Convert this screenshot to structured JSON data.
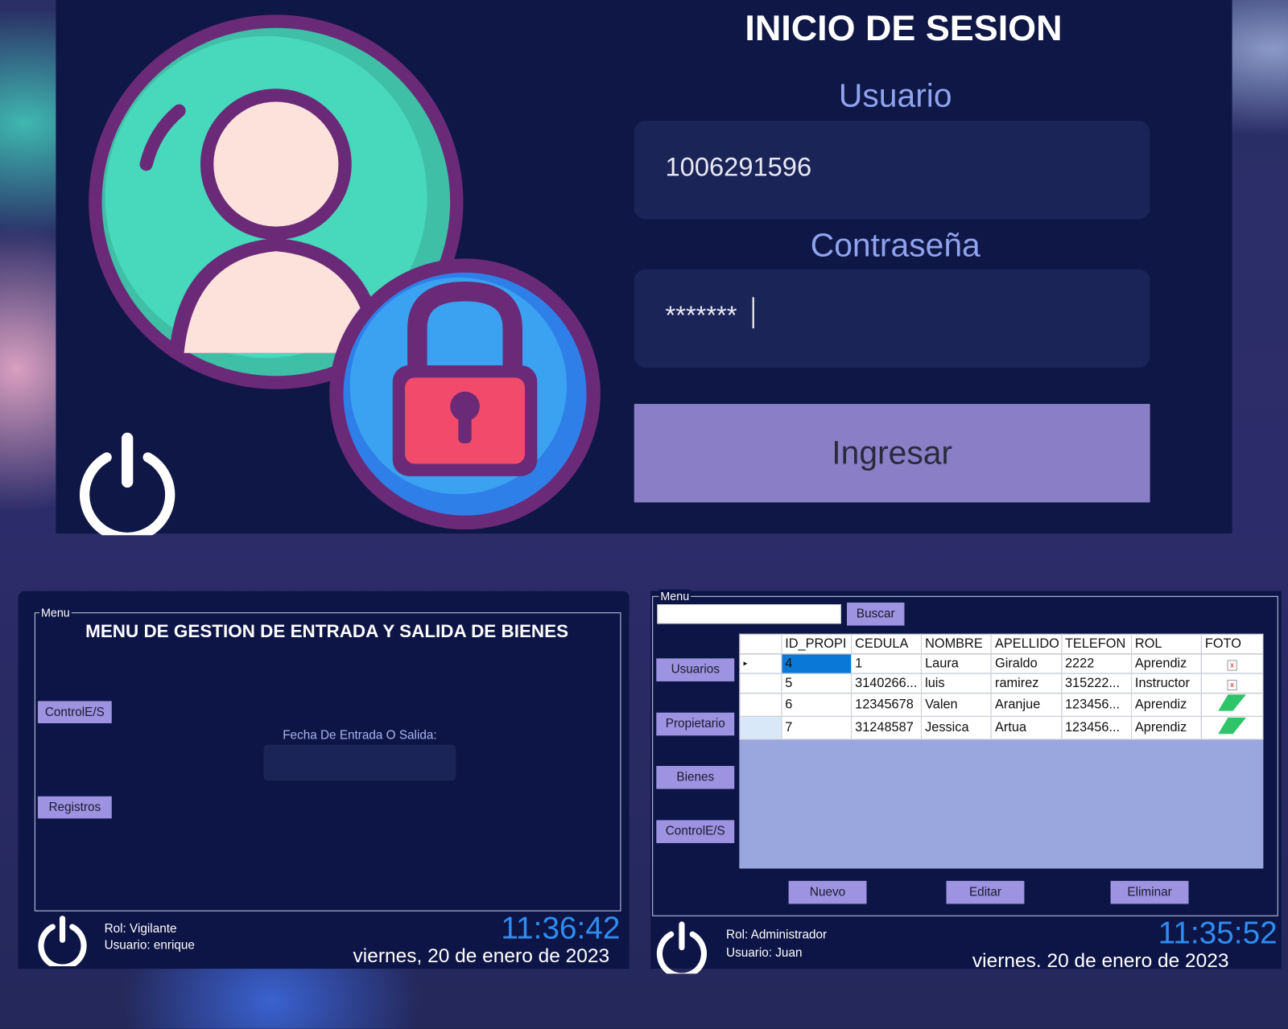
{
  "login": {
    "title": "INICIO DE SESION",
    "user_label": "Usuario",
    "user_value": "1006291596",
    "password_label": "Contraseña",
    "password_value": "*******",
    "submit": "Ingresar"
  },
  "left_panel": {
    "group": "Menu",
    "heading": "MENU DE GESTION DE ENTRADA Y SALIDA DE BIENES",
    "buttons": [
      "ControlE/S",
      "Registros"
    ],
    "date_label": "Fecha De Entrada O Salida:",
    "role": "Rol: Vigilante",
    "user": "Usuario: enrique",
    "time": "11:36:42",
    "date": "viernes, 20 de enero de 2023"
  },
  "right_panel": {
    "group": "Menu",
    "search_value": "",
    "search_button": "Buscar",
    "side_buttons": [
      "Usuarios",
      "Propietario",
      "Bienes",
      "ControlE/S"
    ],
    "columns": [
      "ID_PROPI",
      "CEDULA",
      "NOMBRE",
      "APELLIDO",
      "TELEFON",
      "ROL",
      "FOTO"
    ],
    "rows": [
      [
        "4",
        "1",
        "Laura",
        "Giraldo",
        "2222",
        "Aprendiz",
        "broken-image"
      ],
      [
        "5",
        "3140266...",
        "luis",
        "ramirez",
        "315222...",
        "Instructor",
        "broken-image"
      ],
      [
        "6",
        "12345678",
        "Valen",
        "Aranjue",
        "123456...",
        "Aprendiz",
        "green-logo"
      ],
      [
        "7",
        "31248587",
        "Jessica",
        "Artua",
        "123456...",
        "Aprendiz",
        "green-logo"
      ]
    ],
    "actions": [
      "Nuevo",
      "Editar",
      "Eliminar"
    ],
    "role": "Rol: Administrador",
    "user": "Usuario: Juan",
    "time": "11:35:52",
    "date": "viernes. 20 de enero de 2023"
  },
  "colors": {
    "panel": "#0d1546",
    "accent_button": "#9d93e0",
    "clock": "#2f8cf0",
    "grid_bg": "#9aa6de",
    "selection": "#0a78d7"
  }
}
